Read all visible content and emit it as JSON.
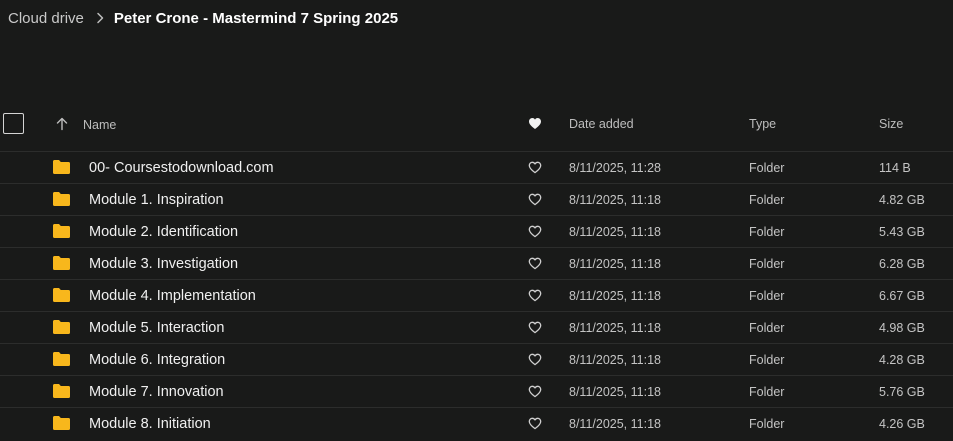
{
  "breadcrumb": {
    "root": "Cloud drive",
    "current": "Peter Crone - Mastermind 7 Spring 2025"
  },
  "columns": {
    "name": "Name",
    "date_added": "Date added",
    "type": "Type",
    "size": "Size"
  },
  "colors": {
    "background": "#191a19",
    "folder": "#f8b71c",
    "divider": "#2c2d2c"
  },
  "rows": [
    {
      "name": "00- Coursestodownload.com",
      "date": "8/11/2025, 11:28",
      "type": "Folder",
      "size": "114 B"
    },
    {
      "name": "Module 1. Inspiration",
      "date": "8/11/2025, 11:18",
      "type": "Folder",
      "size": "4.82 GB"
    },
    {
      "name": "Module 2. Identification",
      "date": "8/11/2025, 11:18",
      "type": "Folder",
      "size": "5.43 GB"
    },
    {
      "name": "Module 3. Investigation",
      "date": "8/11/2025, 11:18",
      "type": "Folder",
      "size": "6.28 GB"
    },
    {
      "name": "Module 4. Implementation",
      "date": "8/11/2025, 11:18",
      "type": "Folder",
      "size": "6.67 GB"
    },
    {
      "name": "Module 5. Interaction",
      "date": "8/11/2025, 11:18",
      "type": "Folder",
      "size": "4.98 GB"
    },
    {
      "name": "Module 6. Integration",
      "date": "8/11/2025, 11:18",
      "type": "Folder",
      "size": "4.28 GB"
    },
    {
      "name": "Module 7. Innovation",
      "date": "8/11/2025, 11:18",
      "type": "Folder",
      "size": "5.76 GB"
    },
    {
      "name": "Module 8. Initiation",
      "date": "8/11/2025, 11:18",
      "type": "Folder",
      "size": "4.26 GB"
    }
  ]
}
